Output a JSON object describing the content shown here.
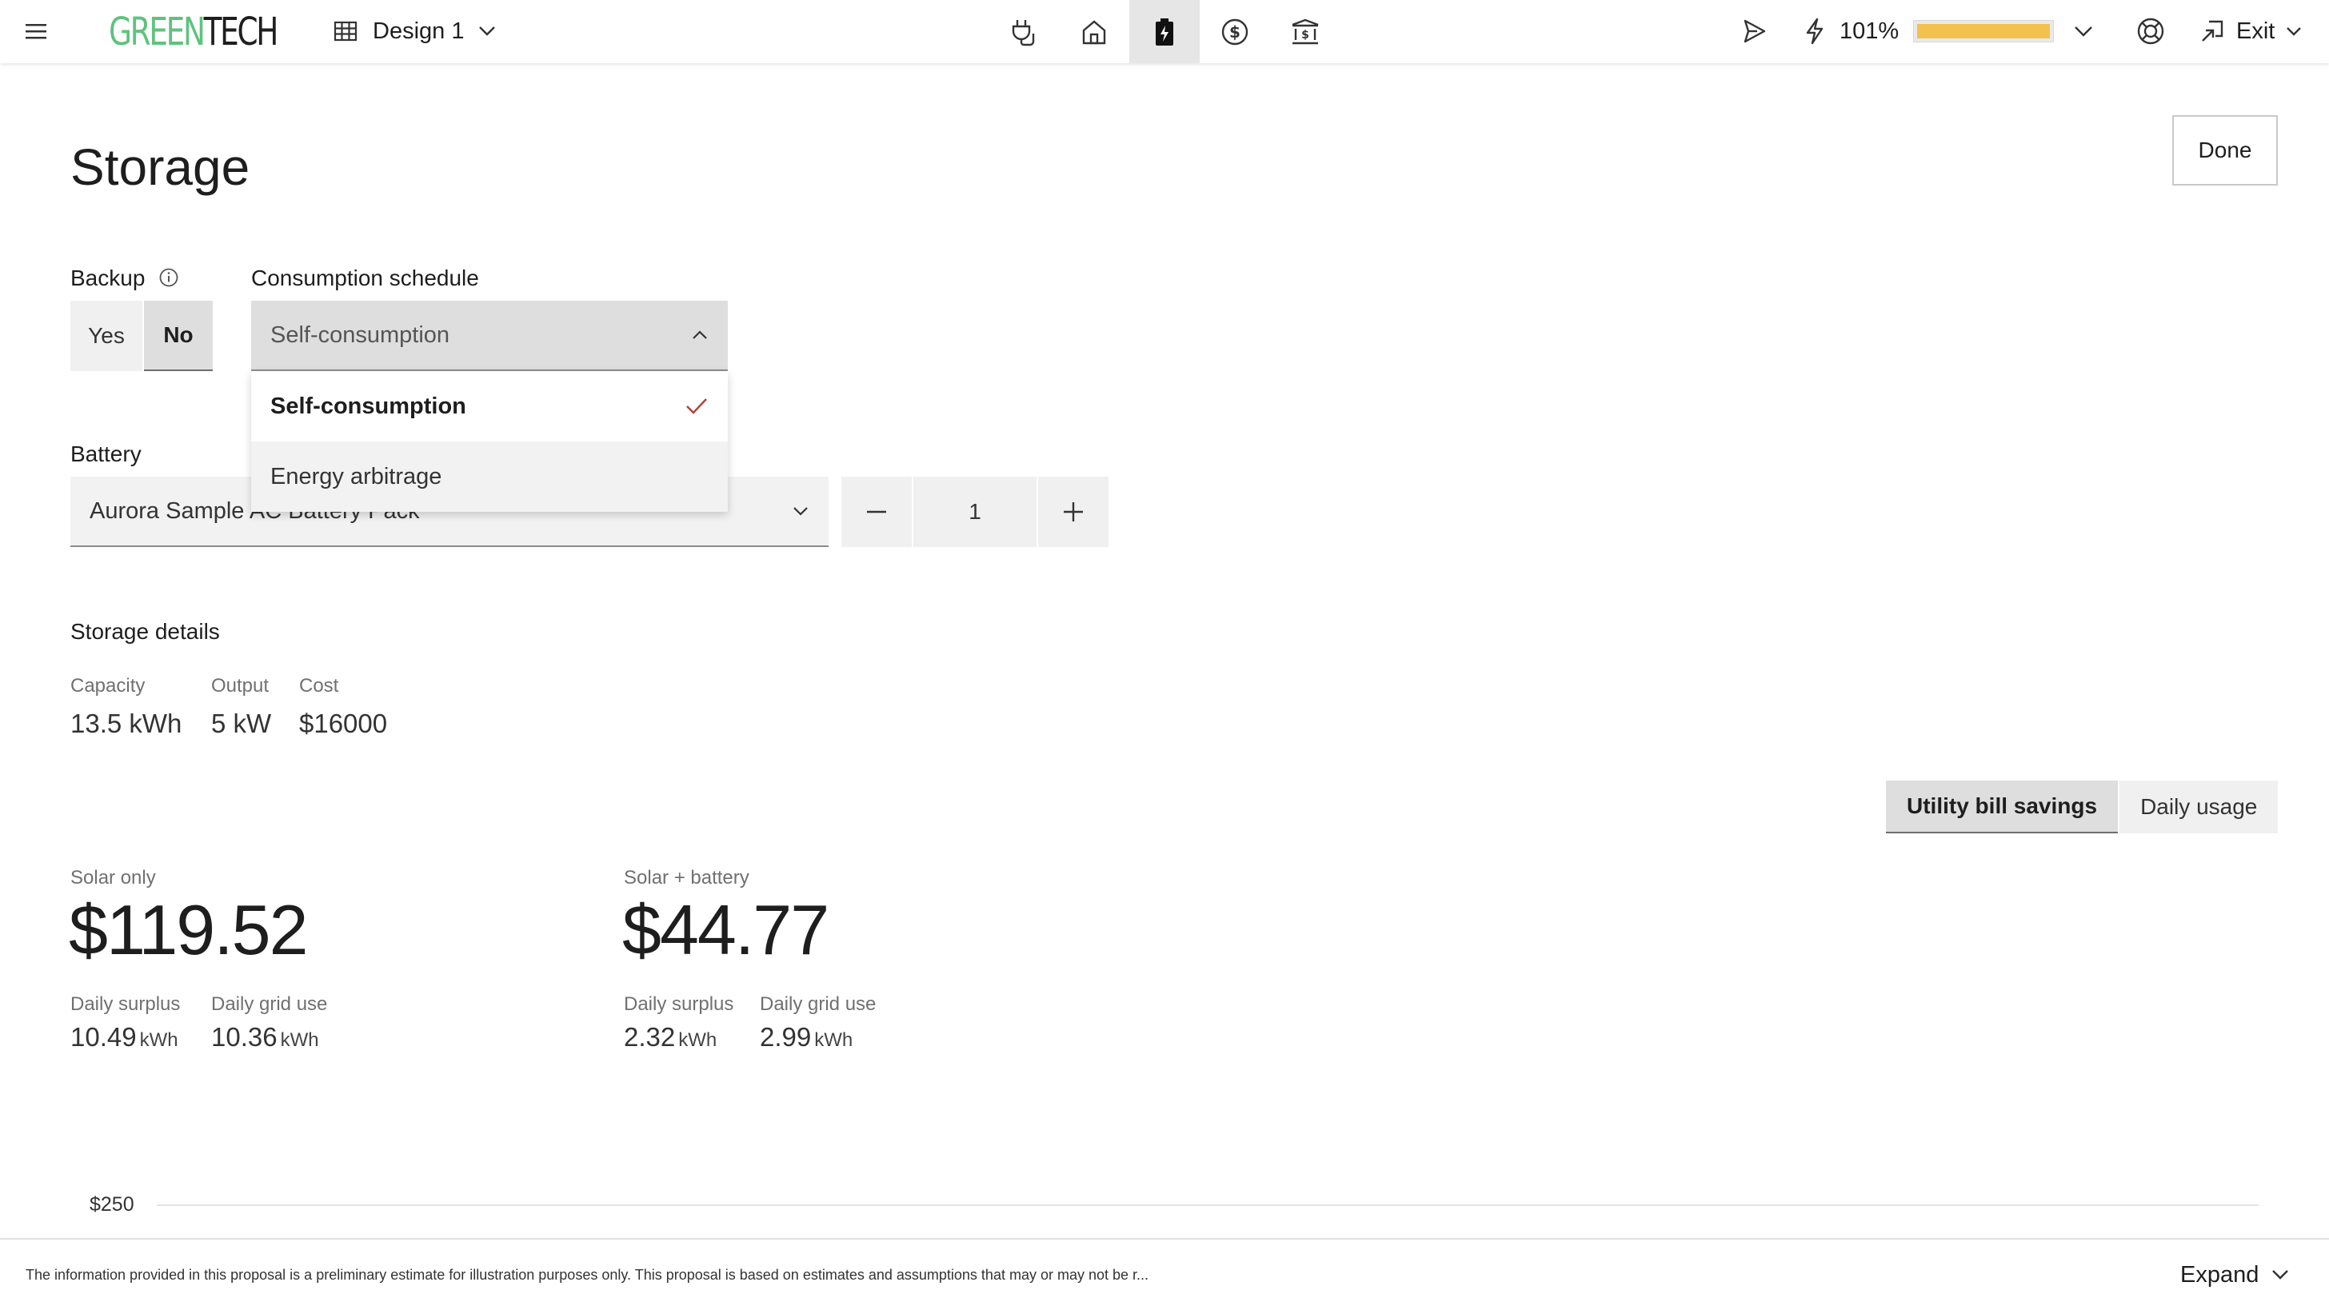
{
  "app": {
    "logo_part1": "GREEN",
    "logo_part2": "TECH",
    "logo_color": "#5fc27e",
    "design_label": "Design 1",
    "production_percent": "101%",
    "production_fraction": 1.0,
    "production_color": "#f2c14e",
    "exit_label": "Exit",
    "nav_icons": [
      "plug-icon",
      "house-icon",
      "battery-icon",
      "dollar-circle-icon",
      "bank-icon"
    ],
    "active_nav": "battery-icon"
  },
  "page": {
    "title": "Storage",
    "done_label": "Done"
  },
  "backup": {
    "label": "Backup",
    "yes_label": "Yes",
    "no_label": "No",
    "selected": "No"
  },
  "schedule": {
    "label": "Consumption schedule",
    "value": "Self-consumption",
    "options": [
      "Self-consumption",
      "Energy arbitrage"
    ],
    "selected_index": 0
  },
  "battery": {
    "label": "Battery",
    "value": "Aurora Sample AC Battery Pack",
    "quantity": "1"
  },
  "storage_details": {
    "heading": "Storage details",
    "capacity_label": "Capacity",
    "capacity_value": "13.5 kWh",
    "output_label": "Output",
    "output_value": "5 kW",
    "cost_label": "Cost",
    "cost_value": "$16000"
  },
  "chart_tabs": {
    "tab1": "Utility bill savings",
    "tab2": "Daily usage",
    "active": "Utility bill savings"
  },
  "solar_only": {
    "label": "Solar only",
    "amount": "$119.52",
    "surplus_label": "Daily surplus",
    "surplus_value": "10.49",
    "grid_label": "Daily grid use",
    "grid_value": "10.36",
    "unit": "kWh"
  },
  "solar_battery": {
    "label": "Solar + battery",
    "amount": "$44.77",
    "surplus_label": "Daily surplus",
    "surplus_value": "2.32",
    "grid_label": "Daily grid use",
    "grid_value": "2.99",
    "unit": "kWh"
  },
  "chart": {
    "y_tick_top": "$250"
  },
  "footer": {
    "disclaimer": "The information provided in this proposal is a preliminary estimate for illustration purposes only. This proposal is based on estimates and assumptions that may or may not be r...",
    "expand_label": "Expand"
  }
}
